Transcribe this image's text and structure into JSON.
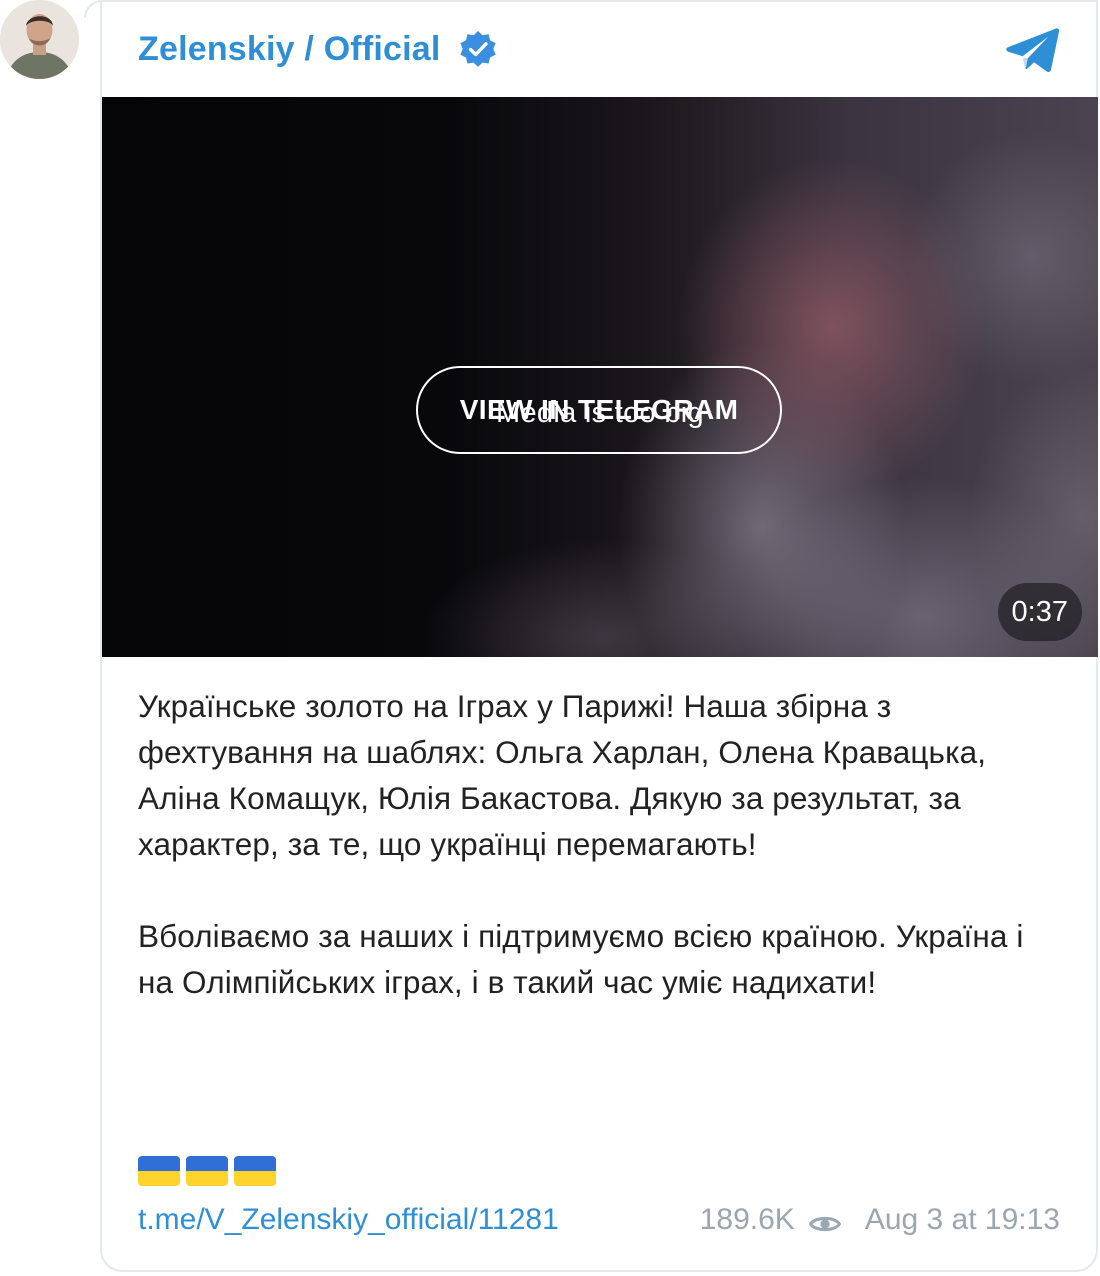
{
  "channel": {
    "name": "Zelenskiy / Official",
    "verified_icon": "verified-badge-icon",
    "source_icon": "telegram-icon",
    "accent_color": "#2f8fd6"
  },
  "media": {
    "message": "Media is too big",
    "button_label": "VIEW IN TELEGRAM",
    "duration": "0:37"
  },
  "post": {
    "paragraph_1": "Українське золото на Іграх у Парижі! Наша збірна з фехтування на шаблях: Ольга Харлан, Олена Кравацька, Аліна Комащук, Юлія Бакастова. Дякую за результат, за характер, за те, що українці перемагають!",
    "paragraph_2": "Вболіваємо за наших і підтримуємо всією країною. Україна і на Олімпійських іграх, і в такий час уміє надихати!",
    "flags": [
      "🇺🇦",
      "🇺🇦",
      "🇺🇦"
    ]
  },
  "footer": {
    "link": "t.me/V_Zelenskiy_official/11281",
    "views": "189.6K",
    "views_icon": "eye-icon",
    "date": "Aug 3 at 19:13"
  }
}
